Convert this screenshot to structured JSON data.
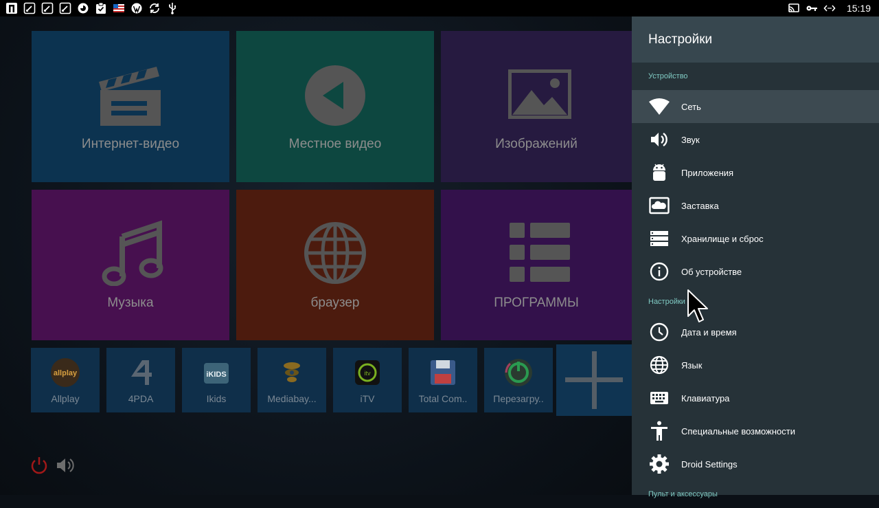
{
  "status_bar": {
    "time": "15:19",
    "left_icons": [
      "app-p-icon",
      "download-icon",
      "download-icon",
      "download-icon",
      "browser-icon",
      "clipboard-check-icon",
      "flag-icon",
      "wordpress-icon",
      "sync-icon",
      "usb-icon"
    ],
    "right_icons": [
      "cast-icon",
      "key-icon",
      "ethernet-icon"
    ]
  },
  "launcher": {
    "tiles": [
      {
        "label": "Интернет-видео",
        "color": "#0c3350"
      },
      {
        "label": "Местное видео",
        "color": "#0d4740"
      },
      {
        "label": "Изображений",
        "color": "#261a40"
      },
      {
        "label": "Музыка",
        "color": "#47104f"
      },
      {
        "label": "браузер",
        "color": "#4c1b0e"
      },
      {
        "label": "ПРОГРАММЫ",
        "color": "#33114b"
      }
    ],
    "apps": [
      {
        "label": "Allplay"
      },
      {
        "label": "4PDA"
      },
      {
        "label": "Ikids"
      },
      {
        "label": "Mediabay..."
      },
      {
        "label": "iTV"
      },
      {
        "label": "Total Com.."
      },
      {
        "label": "Перезагру.."
      }
    ],
    "add_tile_icon": "plus-icon",
    "controls": [
      "power-icon",
      "volume-icon"
    ]
  },
  "settings": {
    "title": "Настройки",
    "sections": [
      {
        "title": "Устройство",
        "items": [
          {
            "label": "Сеть",
            "icon": "wifi-icon",
            "selected": true
          },
          {
            "label": "Звук",
            "icon": "speaker-icon"
          },
          {
            "label": "Приложения",
            "icon": "android-icon"
          },
          {
            "label": "Заставка",
            "icon": "screensaver-icon"
          },
          {
            "label": "Хранилище и сброс",
            "icon": "storage-icon"
          },
          {
            "label": "Об устройстве",
            "icon": "info-icon"
          }
        ]
      },
      {
        "title": "Настройки",
        "items": [
          {
            "label": "Дата и время",
            "icon": "clock-icon"
          },
          {
            "label": "Язык",
            "icon": "globe-icon"
          },
          {
            "label": "Клавиатура",
            "icon": "keyboard-icon"
          },
          {
            "label": "Специальные возможности",
            "icon": "accessibility-icon"
          },
          {
            "label": "Droid Settings",
            "icon": "gear-icon"
          }
        ]
      },
      {
        "title": "Пульт и аксессуары",
        "items": []
      }
    ]
  },
  "colors": {
    "panel_bg": "#263238",
    "panel_header": "#37474f",
    "section_accent": "#80cbc4",
    "selected_row": "#3d4a51"
  }
}
